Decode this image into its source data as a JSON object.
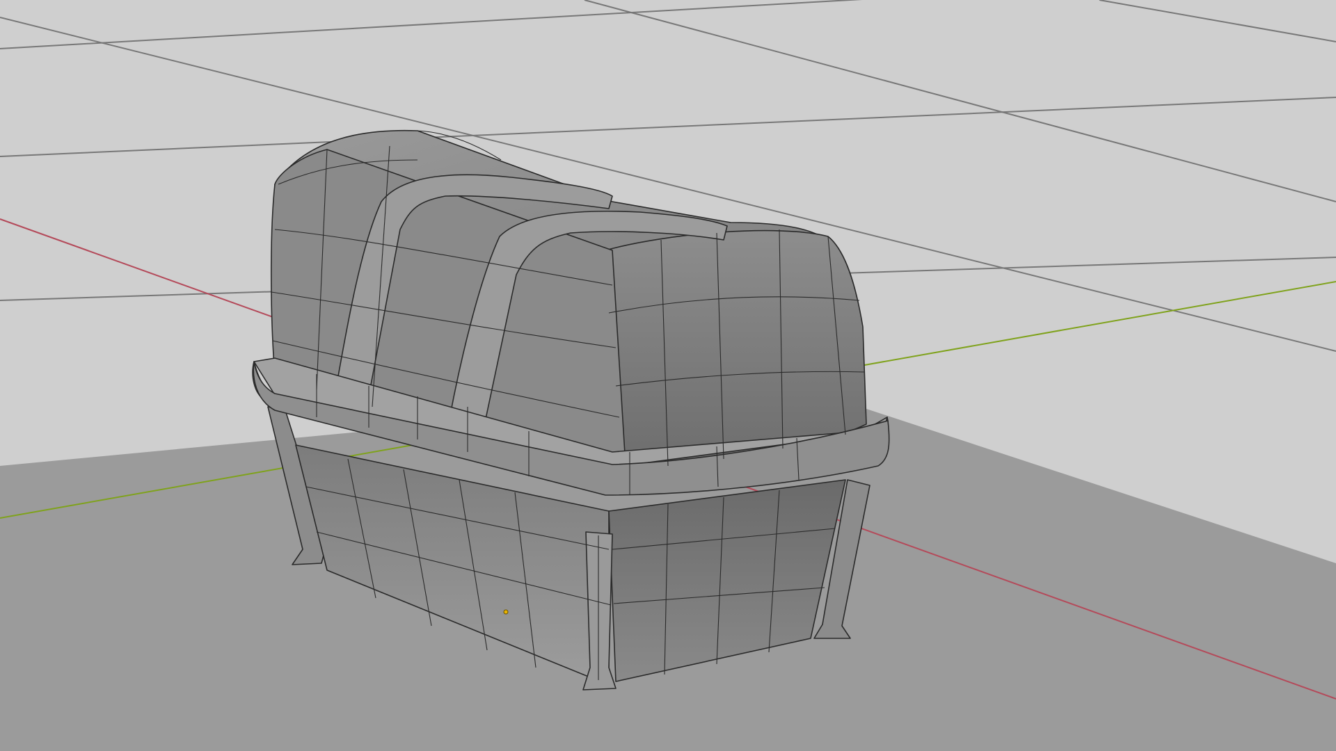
{
  "viewport": {
    "background_color": "#cfcfcf",
    "grid_color": "#777777",
    "x_axis_color": "#b44a5a",
    "y_axis_color": "#7fa21b",
    "ground_color": "#9b9b9b",
    "mesh_base_color": "#8e8e8e",
    "wire_color": "#2a2a2a",
    "origin_color": "#e8b400"
  },
  "scene_object": {
    "type": "mesh",
    "display_mode": "wireframe-overlay",
    "shape": "chest"
  }
}
